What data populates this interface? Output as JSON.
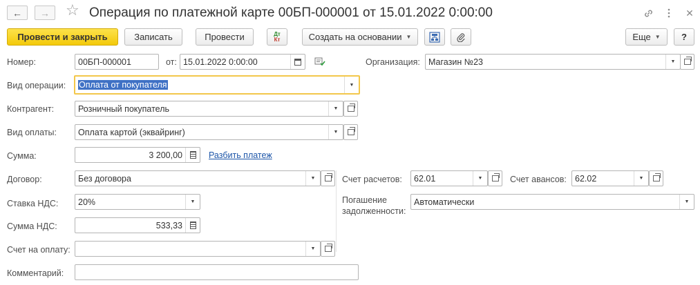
{
  "window": {
    "title": "Операция по платежной карте 00БП-000001 от 15.01.2022 0:00:00",
    "back_icon": "arrow-left-icon",
    "forward_icon": "arrow-right-icon",
    "favorite_icon": "star-icon",
    "link_icon": "link-icon",
    "menu_icon": "more-vertical-icon",
    "close_icon": "close-icon"
  },
  "toolbar": {
    "post_and_close": "Провести и закрыть",
    "save": "Записать",
    "post": "Провести",
    "dt_kt_top": "Дт",
    "dt_kt_bottom": "Кт",
    "create_based_on": "Создать на основании",
    "more": "Еще",
    "help": "?"
  },
  "form": {
    "number_label": "Номер:",
    "number_value": "00БП-000001",
    "from_label": "от:",
    "date_value": "15.01.2022  0:00:00",
    "organization_label": "Организация:",
    "organization_value": "Магазин №23",
    "operation_type_label": "Вид операции:",
    "operation_type_value": "Оплата от покупателя",
    "counterparty_label": "Контрагент:",
    "counterparty_value": "Розничный покупатель",
    "payment_type_label": "Вид оплаты:",
    "payment_type_value": "Оплата картой (эквайринг)",
    "amount_label": "Сумма:",
    "amount_value": "3 200,00",
    "split_payment_link": "Разбить платеж",
    "contract_label": "Договор:",
    "contract_value": "Без договора",
    "settlement_account_label": "Счет расчетов:",
    "settlement_account_value": "62.01",
    "advance_account_label": "Счет авансов:",
    "advance_account_value": "62.02",
    "vat_rate_label": "Ставка НДС:",
    "vat_rate_value": "20%",
    "debt_repayment_label_1": "Погашение",
    "debt_repayment_label_2": "задолженности:",
    "debt_repayment_value": "Автоматически",
    "vat_amount_label": "Сумма НДС:",
    "vat_amount_value": "533,33",
    "invoice_label": "Счет на оплату:",
    "invoice_value": "",
    "comment_label": "Комментарий:",
    "comment_value": ""
  },
  "colors": {
    "primary_button": "#f3c90a",
    "focus_border": "#f3c74a",
    "selection": "#3f71c5",
    "link": "#1c55a8"
  }
}
